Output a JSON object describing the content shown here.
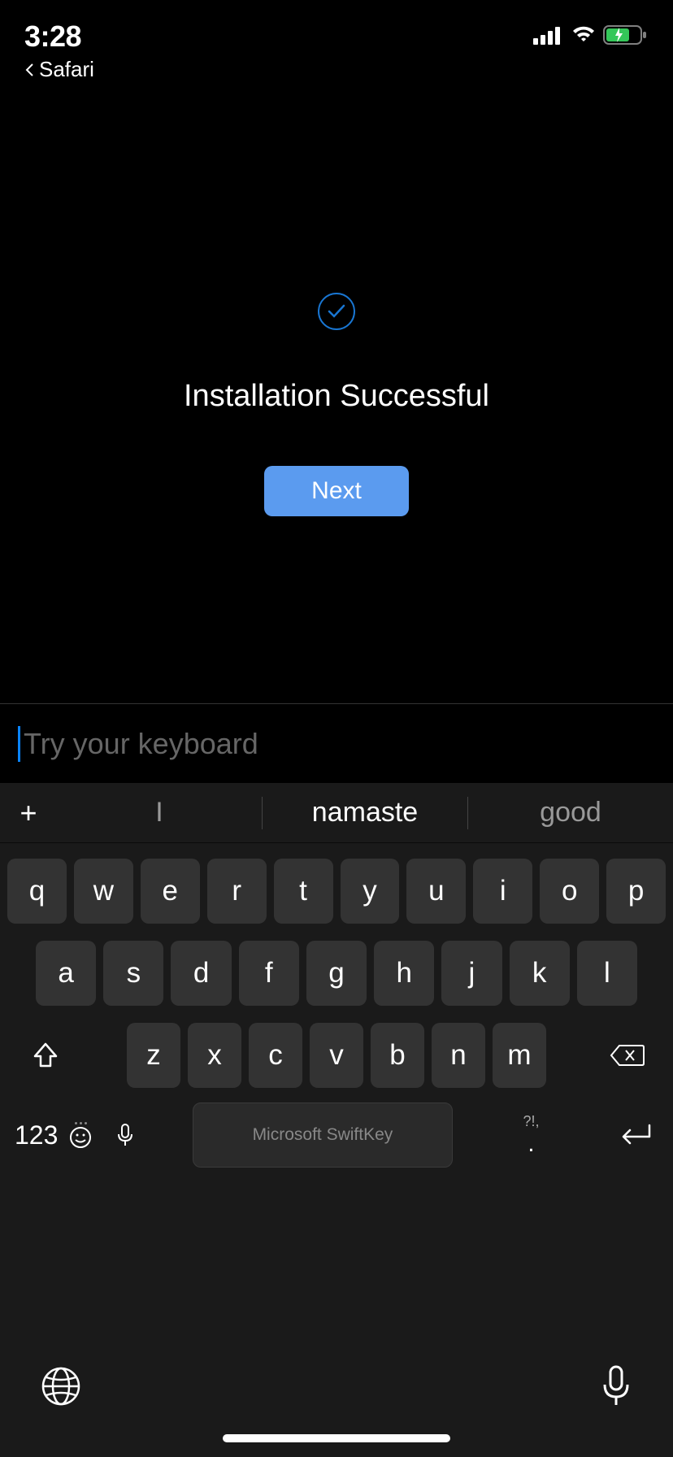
{
  "status": {
    "time": "3:28",
    "back_app": "Safari"
  },
  "main": {
    "heading": "Installation Successful",
    "next_label": "Next"
  },
  "input": {
    "placeholder": "Try your keyboard"
  },
  "keyboard": {
    "suggestions": {
      "left": "I",
      "center": "namaste",
      "right": "good"
    },
    "row1": [
      "q",
      "w",
      "e",
      "r",
      "t",
      "y",
      "u",
      "i",
      "o",
      "p"
    ],
    "row2": [
      "a",
      "s",
      "d",
      "f",
      "g",
      "h",
      "j",
      "k",
      "l"
    ],
    "row3": [
      "z",
      "x",
      "c",
      "v",
      "b",
      "n",
      "m"
    ],
    "num_label": "123",
    "spacebar_label": "Microsoft SwiftKey",
    "punct_top": "?!,",
    "punct_bottom": "."
  }
}
